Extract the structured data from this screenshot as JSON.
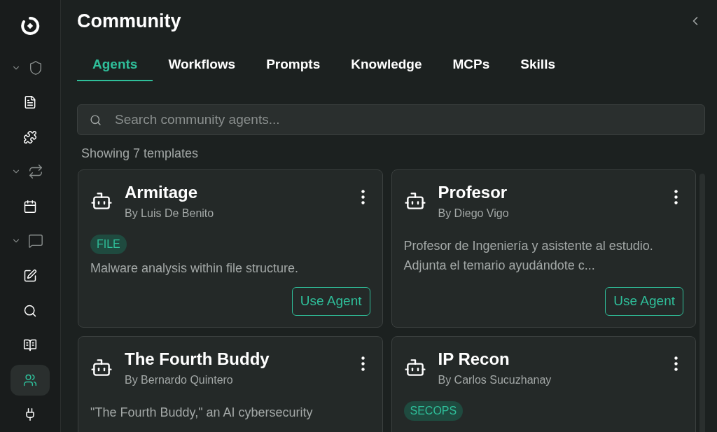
{
  "header": {
    "title": "Community"
  },
  "sidebar": {
    "items": [
      {
        "kind": "logo",
        "selected": false
      },
      {
        "kind": "group",
        "selected": false
      },
      {
        "kind": "item",
        "selected": false
      },
      {
        "kind": "item",
        "selected": false
      },
      {
        "kind": "group",
        "selected": false
      },
      {
        "kind": "item",
        "selected": false
      },
      {
        "kind": "group",
        "selected": false
      },
      {
        "kind": "item",
        "selected": false
      },
      {
        "kind": "item",
        "selected": false
      },
      {
        "kind": "item",
        "selected": false
      },
      {
        "kind": "item",
        "selected": true
      },
      {
        "kind": "item",
        "selected": false
      }
    ]
  },
  "tabs": [
    {
      "label": "Agents",
      "selected": true
    },
    {
      "label": "Workflows",
      "selected": false
    },
    {
      "label": "Prompts",
      "selected": false
    },
    {
      "label": "Knowledge",
      "selected": false
    },
    {
      "label": "MCPs",
      "selected": false
    },
    {
      "label": "Skills",
      "selected": false
    }
  ],
  "search": {
    "placeholder": "Search community agents..."
  },
  "count": "Showing 7 templates",
  "cards": [
    {
      "title": "Armitage",
      "author": "By Luis De Benito",
      "tags": [
        "FILE"
      ],
      "description": "Malware analysis within file structure.",
      "button": "Use Agent"
    },
    {
      "title": "Profesor",
      "author": "By Diego Vigo",
      "description": "Profesor de Ingeniería y asistente al estudio. Adjunta el temario ayudándote c...",
      "button": "Use Agent"
    },
    {
      "title": "The Fourth Buddy",
      "author": "By Bernardo Quintero",
      "description": "\"The Fourth Buddy,\" an AI cybersecurity"
    },
    {
      "title": "IP Recon",
      "author": "By Carlos Sucuzhanay",
      "tags": [
        "SECOPS"
      ]
    }
  ]
}
